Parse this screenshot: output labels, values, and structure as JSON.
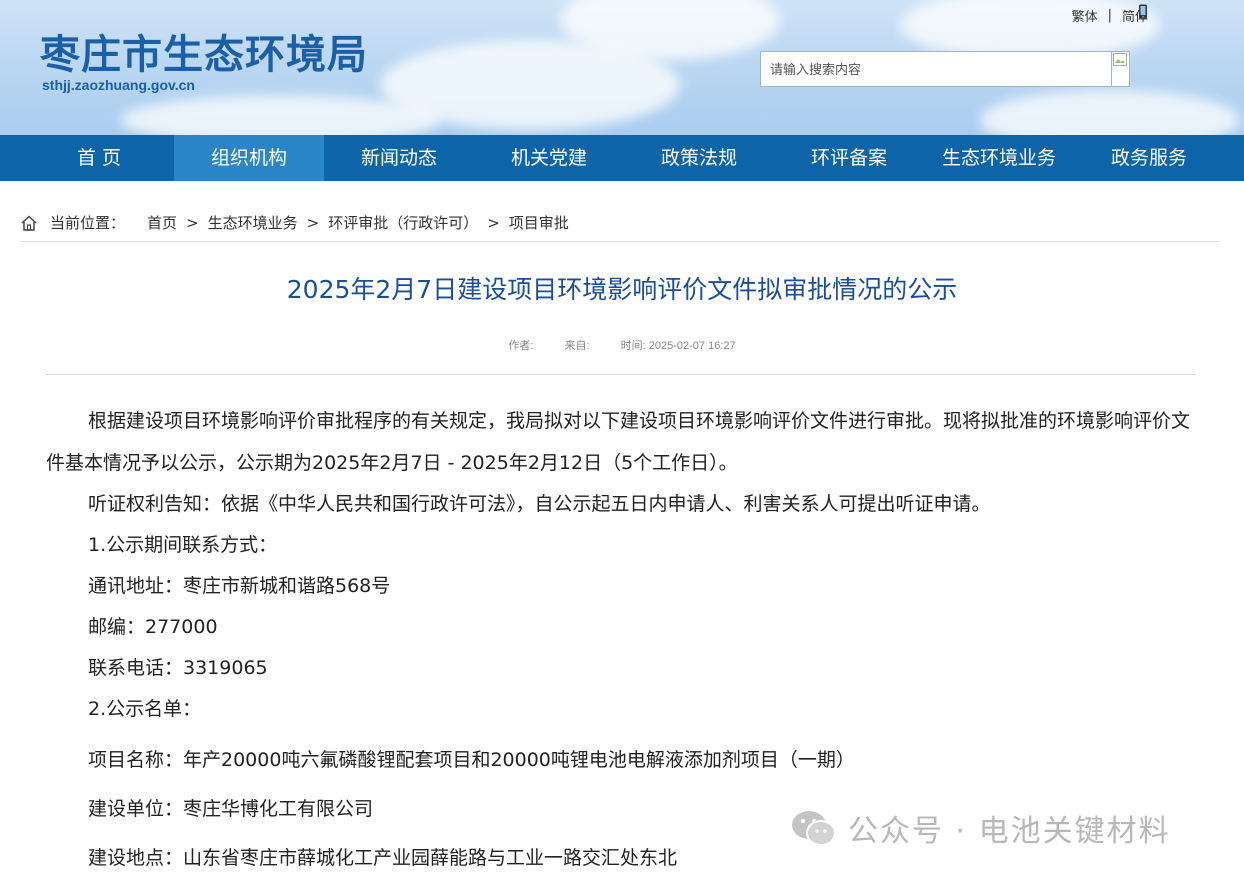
{
  "header": {
    "site_title": "枣庄市生态环境局",
    "site_domain": "sthjj.zaozhuang.gov.cn",
    "lang_traditional": "繁体",
    "lang_separator": "|",
    "lang_simplified": "简体",
    "search_placeholder": "请输入搜索内容"
  },
  "nav": {
    "items": [
      {
        "label": "首 页"
      },
      {
        "label": "组织机构"
      },
      {
        "label": "新闻动态"
      },
      {
        "label": "机关党建"
      },
      {
        "label": "政策法规"
      },
      {
        "label": "环评备案"
      },
      {
        "label": "生态环境业务"
      },
      {
        "label": "政务服务"
      }
    ],
    "active_index": 1
  },
  "breadcrumb": {
    "label": "当前位置：",
    "items": [
      "首页",
      "生态环境业务",
      "环评审批（行政许可）",
      "项目审批"
    ],
    "separator": ">"
  },
  "article": {
    "title": "2025年2月7日建设项目环境影响评价文件拟审批情况的公示",
    "meta_author": "作者:",
    "meta_source": "来自:",
    "meta_time": "时间: 2025-02-07 16:27",
    "para1": "根据建设项目环境影响评价审批程序的有关规定，我局拟对以下建设项目环境影响评价文件进行审批。现将拟批准的环境影响评价文件基本情况予以公示，公示期为2025年2月7日 - 2025年2月12日（5个工作日）。",
    "para2": "听证权利告知：依据《中华人民共和国行政许可法》，自公示起五日内申请人、利害关系人可提出听证申请。",
    "contact_heading": "1.公示期间联系方式：",
    "address": "通讯地址：枣庄市新城和谐路568号",
    "postcode": "邮编：277000",
    "phone": "联系电话：3319065",
    "list_heading": "2.公示名单：",
    "project_name": "项目名称：年产20000吨六氟磷酸锂配套项目和20000吨锂电池电解液添加剂项目（一期）",
    "builder": "建设单位：枣庄华博化工有限公司",
    "location": "建设地点：山东省枣庄市薛城化工产业园薛能路与工业一路交汇处东北"
  },
  "watermark": {
    "text": "公众号 · 电池关键材料",
    "icon": "wechat-icon"
  },
  "colors": {
    "nav_bg": "#0d64a8",
    "nav_active": "#2b86c9",
    "title_blue": "#1a4d9c",
    "brand_blue": "#1a5fa8"
  }
}
